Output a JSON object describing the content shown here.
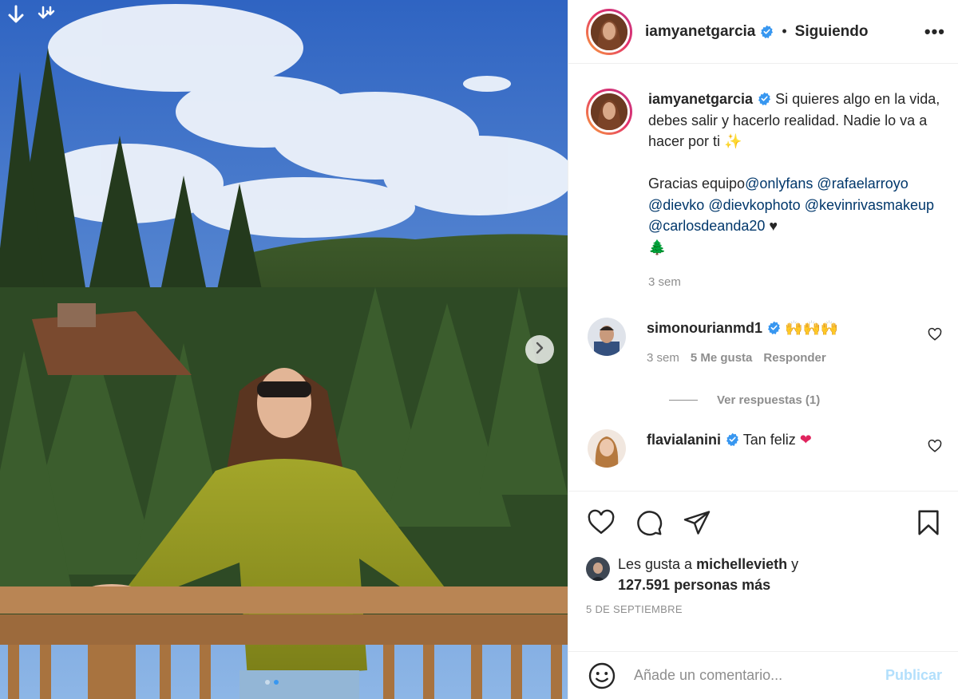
{
  "post": {
    "username": "iamyanetgarcia",
    "follow_status": "Siguiendo",
    "separator": "•",
    "more_label": "•••"
  },
  "caption": {
    "username": "iamyanetgarcia",
    "text_line1": "Si quieres algo en la vida, debes salir y hacerlo realidad. Nadie lo va a hacer por ti",
    "sparkles": "✨",
    "thanks": "Gracias equipo",
    "mentions": [
      "@onlyfans",
      "@rafaelarroyo",
      "@dievko",
      "@dievkophoto",
      "@kevinrivasmakeup",
      "@carlosdeanda20"
    ],
    "heart": "♥",
    "tree": "🌲",
    "time": "3 sem"
  },
  "comments": [
    {
      "username": "simonourianmd1",
      "text": "🙌🙌🙌",
      "time": "3 sem",
      "likes": "5 Me gusta",
      "reply": "Responder",
      "view_replies": "Ver respuestas (1)"
    },
    {
      "username": "flavialanini",
      "text": "Tan feliz",
      "emoji": "❤"
    }
  ],
  "likes": {
    "prefix": "Les gusta a",
    "user": "michellevieth",
    "suffix": "y",
    "count": "127.591 personas más"
  },
  "date": "5 DE SEPTIEMBRE",
  "add_comment": {
    "placeholder": "Añade un comentario...",
    "publish": "Publicar"
  },
  "carousel": {
    "total": 2,
    "current": 2
  },
  "icons": [
    "download-icon",
    "chevron-right-icon",
    "verified-badge-icon",
    "heart-icon",
    "comment-icon",
    "share-icon",
    "bookmark-icon",
    "smiley-icon"
  ],
  "colors": {
    "verified": "#3897f0",
    "mention": "#00376b",
    "publish_disabled": "#b2dffc",
    "muted": "#8e8e8e"
  }
}
